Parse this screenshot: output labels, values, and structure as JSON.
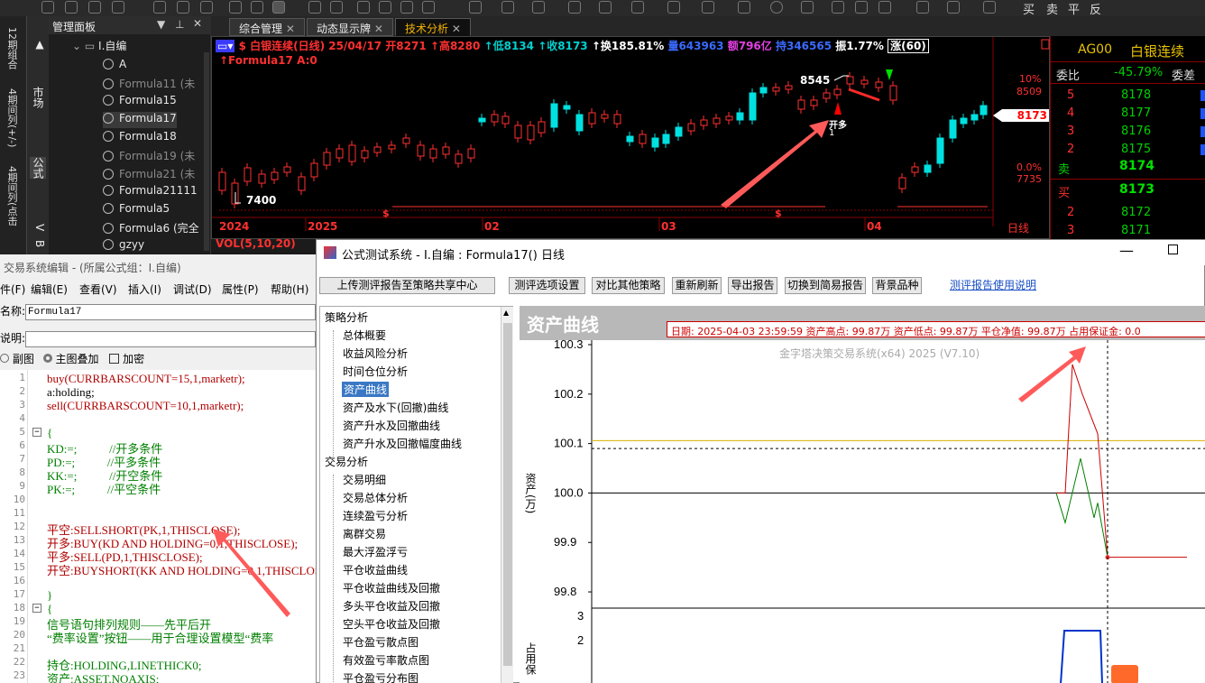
{
  "toolbar": {
    "right_labels": [
      "买",
      "卖",
      "平",
      "反"
    ]
  },
  "vertical_tabs": [
    "12期组合",
    "4期间列(+/-)",
    "4期间列(点击"
  ],
  "side_tabs": {
    "market": "市场",
    "formula": "公式",
    "v": "V",
    "b": "B"
  },
  "manager": {
    "title": "管理面板",
    "root": "I.自编",
    "items": [
      {
        "label": "A",
        "dim": false
      },
      {
        "label": "Formula11 (未",
        "dim": true
      },
      {
        "label": "Formula15",
        "dim": false
      },
      {
        "label": "Formula17",
        "dim": false,
        "selected": true
      },
      {
        "label": "Formula18",
        "dim": false
      },
      {
        "label": "Formula19 (未",
        "dim": true
      },
      {
        "label": "Formula21 (未",
        "dim": true
      },
      {
        "label": "Formula21111",
        "dim": false
      },
      {
        "label": "Formula5",
        "dim": false
      },
      {
        "label": "Formula6 (完全",
        "dim": false
      },
      {
        "label": "gzyy",
        "dim": false
      }
    ]
  },
  "chart_tabs": [
    "综合管理",
    "动态显示牌",
    "技术分析"
  ],
  "chart": {
    "header": [
      "$ 白银连续(日线) 25/04/17",
      "开8271",
      "↑高8280",
      "↑低8134",
      "↑收8173",
      "↑换185.81%",
      "量643963",
      "额796亿",
      "持346565",
      "振1.77%",
      "涨(60)"
    ],
    "formula_line": "↑Formula17 A:0",
    "price_high_label": "8545",
    "price_low_label": "7400",
    "open_long_label": "开多",
    "open_long_count": "1",
    "right_pct_top": "10%",
    "right_price_top": "8509",
    "right_pct_mid": "0.0%",
    "right_price_mid": "7735",
    "current_price_tag": "8173",
    "x_labels": [
      "2024",
      "2025",
      "02",
      "03",
      "04"
    ],
    "dollar_marks": [
      "$",
      "$"
    ],
    "timeframe": "日线",
    "vol_label": "VOL(5,10,20)",
    "vol_right": "VO"
  },
  "quote": {
    "code": "AG00",
    "name": "白银连续",
    "weibi_label": "委比",
    "weibi_value": "-45.79%",
    "weicha_label": "委差",
    "sell_rows": [
      [
        "5",
        "8178"
      ],
      [
        "4",
        "8177"
      ],
      [
        "3",
        "8176"
      ],
      [
        "2",
        "8175"
      ]
    ],
    "sell1_label": "卖",
    "sell1_price": "8174",
    "buy1_label": "买",
    "buy1_price": "8173",
    "buy_rows": [
      [
        "2",
        "8172"
      ],
      [
        "3",
        "8171"
      ]
    ]
  },
  "editor": {
    "title": "交易系统编辑 - (所属公式组：I.自编)",
    "menu": [
      "件(F)",
      "编辑(E)",
      "查看(V)",
      "插入(I)",
      "调试(D)",
      "属性(P)",
      "帮助(H)"
    ],
    "name_label": "名称:",
    "name_value": "Formula17",
    "desc_label": "说明:",
    "options": [
      "副图",
      "主图叠加",
      "加密"
    ],
    "lines": [
      {
        "n": "1",
        "t": "buy(CURRBARSCOUNT=15,1,marketr);"
      },
      {
        "n": "2",
        "t": "a:holding;"
      },
      {
        "n": "3",
        "t": "sell(CURRBARSCOUNT=10,1,marketr);"
      },
      {
        "n": "4",
        "t": ""
      },
      {
        "n": "5",
        "t": "{"
      },
      {
        "n": "6",
        "t": "KD:=;           //开多条件"
      },
      {
        "n": "7",
        "t": "PD:=;           //平多条件"
      },
      {
        "n": "8",
        "t": "KK:=;           //开空条件"
      },
      {
        "n": "9",
        "t": "PK:=;           //平空条件"
      },
      {
        "n": "10",
        "t": ""
      },
      {
        "n": "11",
        "t": ""
      },
      {
        "n": "12",
        "t": "平空:SELLSHORT(PK,1,THISCLOSE);"
      },
      {
        "n": "13",
        "t": "开多:BUY(KD AND HOLDING=0,1,THISCLOSE);"
      },
      {
        "n": "14",
        "t": "平多:SELL(PD,1,THISCLOSE);"
      },
      {
        "n": "15",
        "t": "开空:BUYSHORT(KK AND HOLDING=0,1,THISCLOSE);"
      },
      {
        "n": "16",
        "t": ""
      },
      {
        "n": "17",
        "t": "}"
      },
      {
        "n": "18",
        "t": "{"
      },
      {
        "n": "19",
        "t": "信号语句排列规则——先平后开"
      },
      {
        "n": "20",
        "t": "“费率设置”按钮——用于合理设置模型“费率"
      },
      {
        "n": "21",
        "t": ""
      },
      {
        "n": "22",
        "t": "持仓:HOLDING,LINETHICK0;"
      },
      {
        "n": "23",
        "t": "资产:ASSET,NOAXIS;"
      }
    ]
  },
  "dialog": {
    "title": "公式测试系统 - I.自编 : Formula17() 日线",
    "buttons": [
      "上传测评报告至策略共享中心",
      "测评选项设置",
      "对比其他策略",
      "重新刷新",
      "导出报告",
      "切换到简易报告",
      "背景品种"
    ],
    "help_link": "测评报告使用说明",
    "tree": [
      {
        "label": "策略分析",
        "h": true
      },
      {
        "label": "总体概要"
      },
      {
        "label": "收益风险分析"
      },
      {
        "label": "时间仓位分析"
      },
      {
        "label": "资产曲线",
        "selected": true
      },
      {
        "label": "资产及水下(回撤)曲线"
      },
      {
        "label": "资产升水及回撤曲线"
      },
      {
        "label": "资产升水及回撤幅度曲线"
      },
      {
        "label": "交易分析",
        "h": true
      },
      {
        "label": "交易明细"
      },
      {
        "label": "交易总体分析"
      },
      {
        "label": "连续盈亏分析"
      },
      {
        "label": "离群交易"
      },
      {
        "label": "最大浮盈浮亏"
      },
      {
        "label": "平仓收益曲线"
      },
      {
        "label": "平仓收益曲线及回撤"
      },
      {
        "label": "多头平仓收益及回撤"
      },
      {
        "label": "空头平仓收益及回撤"
      },
      {
        "label": "平仓盈亏散点图"
      },
      {
        "label": "有效盈亏率散点图"
      },
      {
        "label": "平仓盈亏分布图"
      }
    ],
    "plot": {
      "heading": "资产曲线",
      "info": "日期: 2025-04-03 23:59:59  资产高点: 99.87万  资产低点: 99.87万  平仓净值: 99.87万  占用保证金: 0.0",
      "watermark": "金字塔决策交易系统(x64) 2025 (V7.10)",
      "ylabel": "资产(万)",
      "ylabel2": "占用保",
      "y_ticks": [
        "100.3",
        "100.2",
        "100.1",
        "100.0",
        "99.9",
        "99.8"
      ],
      "y2_ticks": [
        "3",
        "2"
      ]
    }
  },
  "chart_data": {
    "type": "line",
    "title": "资产曲线",
    "ylabel": "资产(万)",
    "ylim": [
      99.78,
      100.3
    ],
    "series": [
      {
        "color": "#cc0000",
        "values": [
          100.0,
          100.0,
          100.26,
          100.2,
          100.12,
          99.87,
          99.87
        ]
      },
      {
        "color": "#007f00",
        "values": [
          100.0,
          99.94,
          100.07,
          99.95,
          99.98,
          99.87
        ]
      }
    ],
    "reference_lines": [
      100.106,
      100.09,
      100.0
    ]
  }
}
